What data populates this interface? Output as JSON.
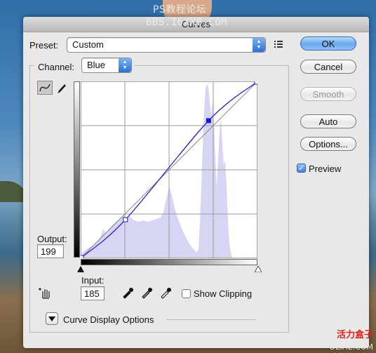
{
  "watermark": {
    "line1": "PS教程论坛",
    "line2": "BBS.16XX8.COM",
    "corner1": "活力盒子",
    "corner2": "OLIHE.COM"
  },
  "dialog": {
    "title": "Curves",
    "preset_label": "Preset:",
    "preset_value": "Custom",
    "channel_label": "Channel:",
    "channel_value": "Blue",
    "output_label": "Output:",
    "output_value": "199",
    "input_label": "Input:",
    "input_value": "185",
    "show_clipping_label": "Show Clipping",
    "show_clipping_checked": false,
    "curve_display_options_label": "Curve Display Options",
    "preview_label": "Preview",
    "preview_checked": true
  },
  "buttons": {
    "ok": "OK",
    "cancel": "Cancel",
    "smooth": "Smooth",
    "auto": "Auto",
    "options": "Options..."
  },
  "curve": {
    "points": [
      [
        0,
        0
      ],
      [
        64,
        55
      ],
      [
        185,
        199
      ],
      [
        255,
        255
      ]
    ],
    "histogram_color": "#d6d6f4",
    "curve_color": "#1a1ad0"
  },
  "icons": {
    "curve_tool": "curve-icon",
    "pencil_tool": "pencil-icon",
    "preset_menu": "list-menu-icon",
    "hand_tool": "targeted-adjustment-icon",
    "black_eyedropper": "eyedropper-black-icon",
    "gray_eyedropper": "eyedropper-gray-icon",
    "white_eyedropper": "eyedropper-white-icon",
    "disclosure": "disclosure-triangle-icon"
  }
}
